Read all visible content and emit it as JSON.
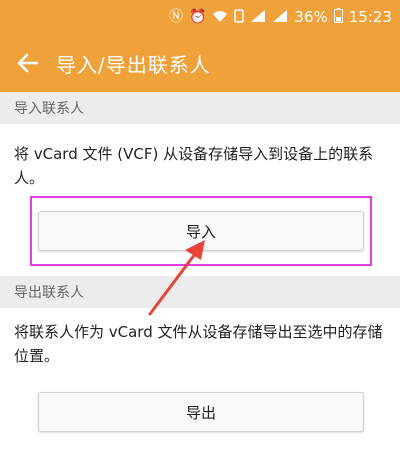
{
  "status_bar": {
    "icons": [
      "n-notification-icon",
      "alarm-icon",
      "wifi-icon",
      "sim-icon",
      "signal-4g-icon",
      "signal-3g-icon"
    ],
    "battery": "36%",
    "time": "15:23"
  },
  "app_bar": {
    "back_icon": "arrow-left-icon",
    "title": "导入/导出联系人"
  },
  "import_section": {
    "header": "导入联系人",
    "description": "将 vCard 文件 (VCF) 从设备存储导入到设备上的联系人。",
    "button_label": "导入"
  },
  "export_section": {
    "header": "导出联系人",
    "description": "将联系人作为 vCard 文件从设备存储导出至选中的存储位置。",
    "button_label": "导出"
  },
  "colors": {
    "accent": "#f0a23a",
    "highlight": "#e63ee0",
    "arrow": "#e8443a"
  }
}
